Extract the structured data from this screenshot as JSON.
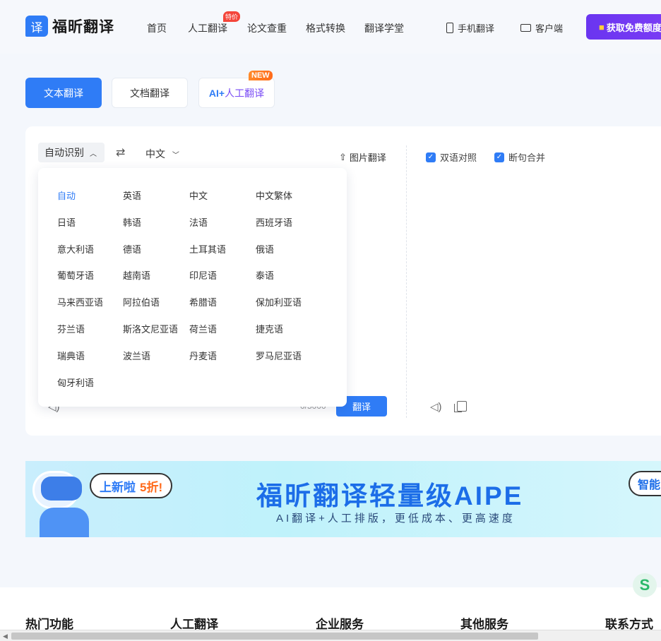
{
  "brand": {
    "logo_glyph": "译",
    "name": "福昕翻译",
    "accent": "#2f7cf6"
  },
  "nav": {
    "items": [
      "首页",
      "人工翻译",
      "论文查重",
      "格式转换",
      "翻译学堂"
    ],
    "hot_badge": "特价",
    "mobile": "手机翻译",
    "client": "客户端",
    "cta": "获取免费额度"
  },
  "tabs": {
    "text": "文本翻译",
    "doc": "文档翻译",
    "ai_prefix": "AI+",
    "ai_rest": "人工翻译",
    "new_badge": "NEW"
  },
  "translator": {
    "source_lang": "自动识别",
    "target_lang": "中文",
    "image_translate": "图片翻译",
    "bilingual": "双语对照",
    "merge_sentences": "断句合并",
    "counter": "0/5000",
    "translate_button": "翻译"
  },
  "language_options": [
    [
      "自动",
      "英语",
      "中文",
      "中文繁体"
    ],
    [
      "日语",
      "韩语",
      "法语",
      "西班牙语"
    ],
    [
      "意大利语",
      "德语",
      "土耳其语",
      "俄语"
    ],
    [
      "葡萄牙语",
      "越南语",
      "印尼语",
      "泰语"
    ],
    [
      "马来西亚语",
      "阿拉伯语",
      "希腊语",
      "保加利亚语"
    ],
    [
      "芬兰语",
      "斯洛文尼亚语",
      "荷兰语",
      "捷克语"
    ],
    [
      "瑞典语",
      "波兰语",
      "丹麦语",
      "罗马尼亚语"
    ],
    [
      "匈牙利语"
    ]
  ],
  "banner": {
    "bubble_text": "上新啦",
    "bubble_highlight": "5折!",
    "title": "福昕翻译轻量级AIPE",
    "subtitle": "AI翻译+人工排版，更低成本、更高速度",
    "side_button": "智能"
  },
  "footer": {
    "columns": [
      "热门功能",
      "人工翻译",
      "企业服务",
      "其他服务",
      "联系方式"
    ]
  }
}
